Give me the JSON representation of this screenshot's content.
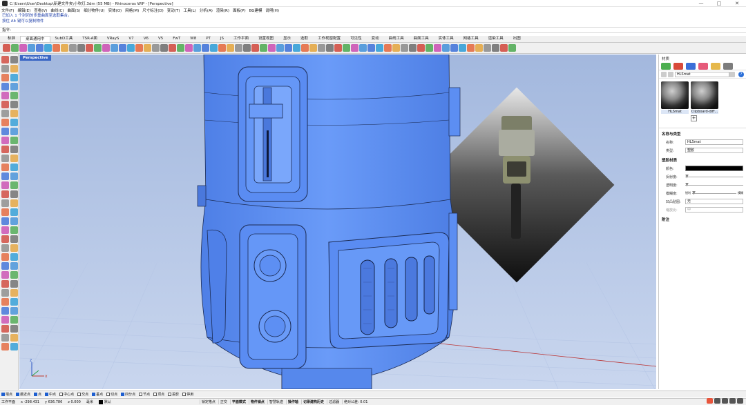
{
  "titlebar": {
    "title": "C:\\Users\\User\\Desktop\\新建文件夹\\小吹灯.3dm (55 MB) - Rhinoceros WIP - [Perspective]",
    "min": "—",
    "max": "□",
    "close": "✕"
  },
  "menu": [
    "文件(F)",
    "编辑(E)",
    "查看(V)",
    "曲线(C)",
    "曲面(S)",
    "细分物件(U)",
    "实体(O)",
    "网格(M)",
    "尺寸标注(D)",
    "变动(T)",
    "工具(L)",
    "分析(A)",
    "渲染(R)",
    "面板(P)",
    "BG建模",
    "说明(H)"
  ],
  "command_history": [
    "已加入 1 个封闭的多重曲面至选取集合。",
    "按住 Alt 键可以复制物件"
  ],
  "command_prompt": "指令:",
  "tabs": [
    "标准",
    "桌面通用中",
    "SubD工具",
    "TSR-A面",
    "VRayS",
    "V7",
    "V6",
    "V5",
    "FwT",
    "W8",
    "PT",
    "JS",
    "工作平面",
    "设置视图",
    "显示",
    "选取",
    "工作视窗配置",
    "可见性",
    "变动",
    "曲线工具",
    "曲面工具",
    "实体工具",
    "网格工具",
    "渲染工具",
    "出图"
  ],
  "active_tab_index": 1,
  "viewport": {
    "label": "Perspective"
  },
  "panel": {
    "title": "材质",
    "filter_text": "HLSmat",
    "help": "?",
    "add": "+",
    "materials": [
      {
        "name": "HLSmat"
      },
      {
        "name": "Clipboard-diff..."
      }
    ],
    "section_name": "名称与类型",
    "name_label": "名称:",
    "name_value": "HLSmat",
    "type_label": "类型:",
    "type_value": "塑胶",
    "section_plastic": "塑胶材质",
    "color_label": "颜色:",
    "reflect_label": "反射度:",
    "transparency_label": "透明度:",
    "blur_label": "模糊度:",
    "blur_left": "锐利",
    "blur_right": "模糊",
    "bump_label": "凹凸贴图:",
    "bump_value": "无",
    "scale_label": "缩放比:",
    "scale_value": "中",
    "section_notes": "附注"
  },
  "osnaps": [
    {
      "label": "端点",
      "on": true
    },
    {
      "label": "最近点",
      "on": true
    },
    {
      "label": "点",
      "on": true
    },
    {
      "label": "中点",
      "on": true
    },
    {
      "label": "中心点",
      "on": false
    },
    {
      "label": "交点",
      "on": false
    },
    {
      "label": "垂点",
      "on": true
    },
    {
      "label": "切点",
      "on": false
    },
    {
      "label": "四分点",
      "on": true
    },
    {
      "label": "节点",
      "on": false
    },
    {
      "label": "顶点",
      "on": false
    },
    {
      "label": "投影",
      "on": false
    },
    {
      "label": "停用",
      "on": false
    }
  ],
  "status": {
    "cplane": "工作平面",
    "x": "x -298.431",
    "y": "y 636.786",
    "z": "z 0.000",
    "units": "毫米",
    "layer": "默认",
    "buttons": [
      "锁定格点",
      "正交",
      "平面模式",
      "物件锁点",
      "智慧轨迹",
      "操作轴",
      "记录建构历史",
      "过滤器",
      "绝对公差: 0.01"
    ],
    "bold_buttons": [
      "平面模式",
      "物件锁点",
      "操作轴",
      "记录建构历史"
    ]
  },
  "colors": {
    "viewport_bg": "#a8bde0",
    "model_blue": "#5b8ff2",
    "active_blue": "#3a66c4"
  }
}
